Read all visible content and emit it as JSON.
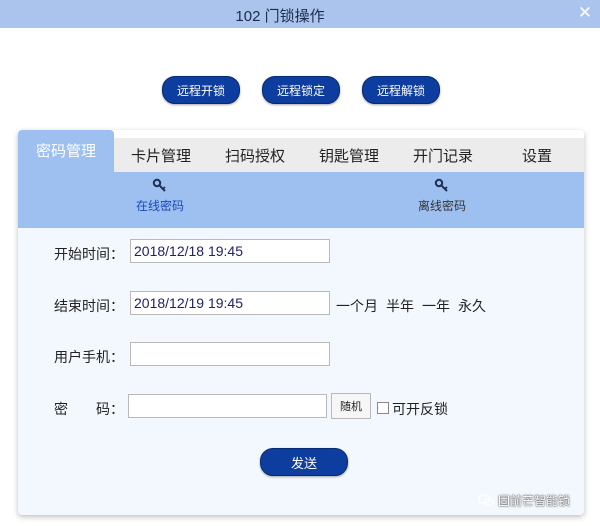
{
  "window": {
    "title": "102 门锁操作",
    "close_glyph": "✕"
  },
  "actions": [
    {
      "label": "远程开锁"
    },
    {
      "label": "远程锁定"
    },
    {
      "label": "远程解锁"
    }
  ],
  "tabs": [
    {
      "label": "密码管理",
      "active": true
    },
    {
      "label": "卡片管理"
    },
    {
      "label": "扫码授权"
    },
    {
      "label": "钥匙管理"
    },
    {
      "label": "开门记录"
    },
    {
      "label": "设置"
    }
  ],
  "subtabs": [
    {
      "label": "在线密码",
      "icon": "key-icon",
      "active": true
    },
    {
      "label": "离线密码",
      "icon": "key-icon"
    }
  ],
  "form": {
    "start_label": "开始时间：",
    "start_value": "2018/12/18 19:45",
    "end_label": "结束时间：",
    "end_value": "2018/12/19 19:45",
    "quick_ranges": [
      "一个月",
      "半年",
      "一年",
      "永久"
    ],
    "phone_label": "用户手机：",
    "phone_value": "",
    "password_label": "密　　码：",
    "password_value": "",
    "random_label": "随机",
    "reverse_lock_label": "可开反锁",
    "reverse_lock_checked": false,
    "send_label": "发送"
  },
  "watermark": {
    "text": "固前芒智能锁",
    "icon": "wechat-icon"
  },
  "colors": {
    "titlebar": "#aac4ee",
    "tab_active": "#9ec0f1",
    "button": "#0d3d9e",
    "panel": "#f3f8ff"
  }
}
